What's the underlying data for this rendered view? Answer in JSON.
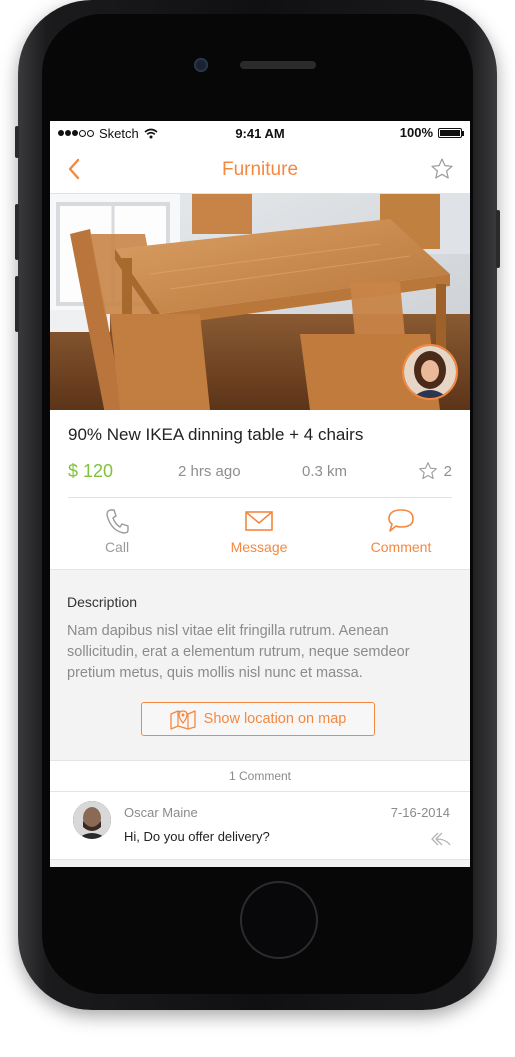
{
  "status_bar": {
    "carrier": "Sketch",
    "time": "9:41 AM",
    "battery": "100%"
  },
  "navbar": {
    "title": "Furniture",
    "back_icon": "chevron-left-icon",
    "favorite_icon": "star-outline-icon"
  },
  "listing": {
    "title": "90% New IKEA dinning table + 4 chairs",
    "price": "$ 120",
    "posted": "2 hrs ago",
    "distance": "0.3 km",
    "favorites_count": "2"
  },
  "actions": [
    {
      "label": "Call",
      "icon": "phone-icon"
    },
    {
      "label": "Message",
      "icon": "envelope-icon"
    },
    {
      "label": "Comment",
      "icon": "speech-bubble-icon"
    }
  ],
  "description": {
    "heading": "Description",
    "body": "Nam dapibus nisl vitae elit fringilla rutrum. Aenean sollicitudin, erat a elementum rutrum, neque semdeor pretium metus, quis mollis nisl nunc et massa.",
    "map_button": "Show location on map"
  },
  "comments": {
    "count_label": "1 Comment",
    "items": [
      {
        "author": "Oscar Maine",
        "date": "7-16-2014",
        "text": "Hi, Do you offer delivery?"
      }
    ]
  },
  "colors": {
    "accent": "#f58840",
    "price": "#80c23a",
    "muted": "#8b8b8b"
  }
}
